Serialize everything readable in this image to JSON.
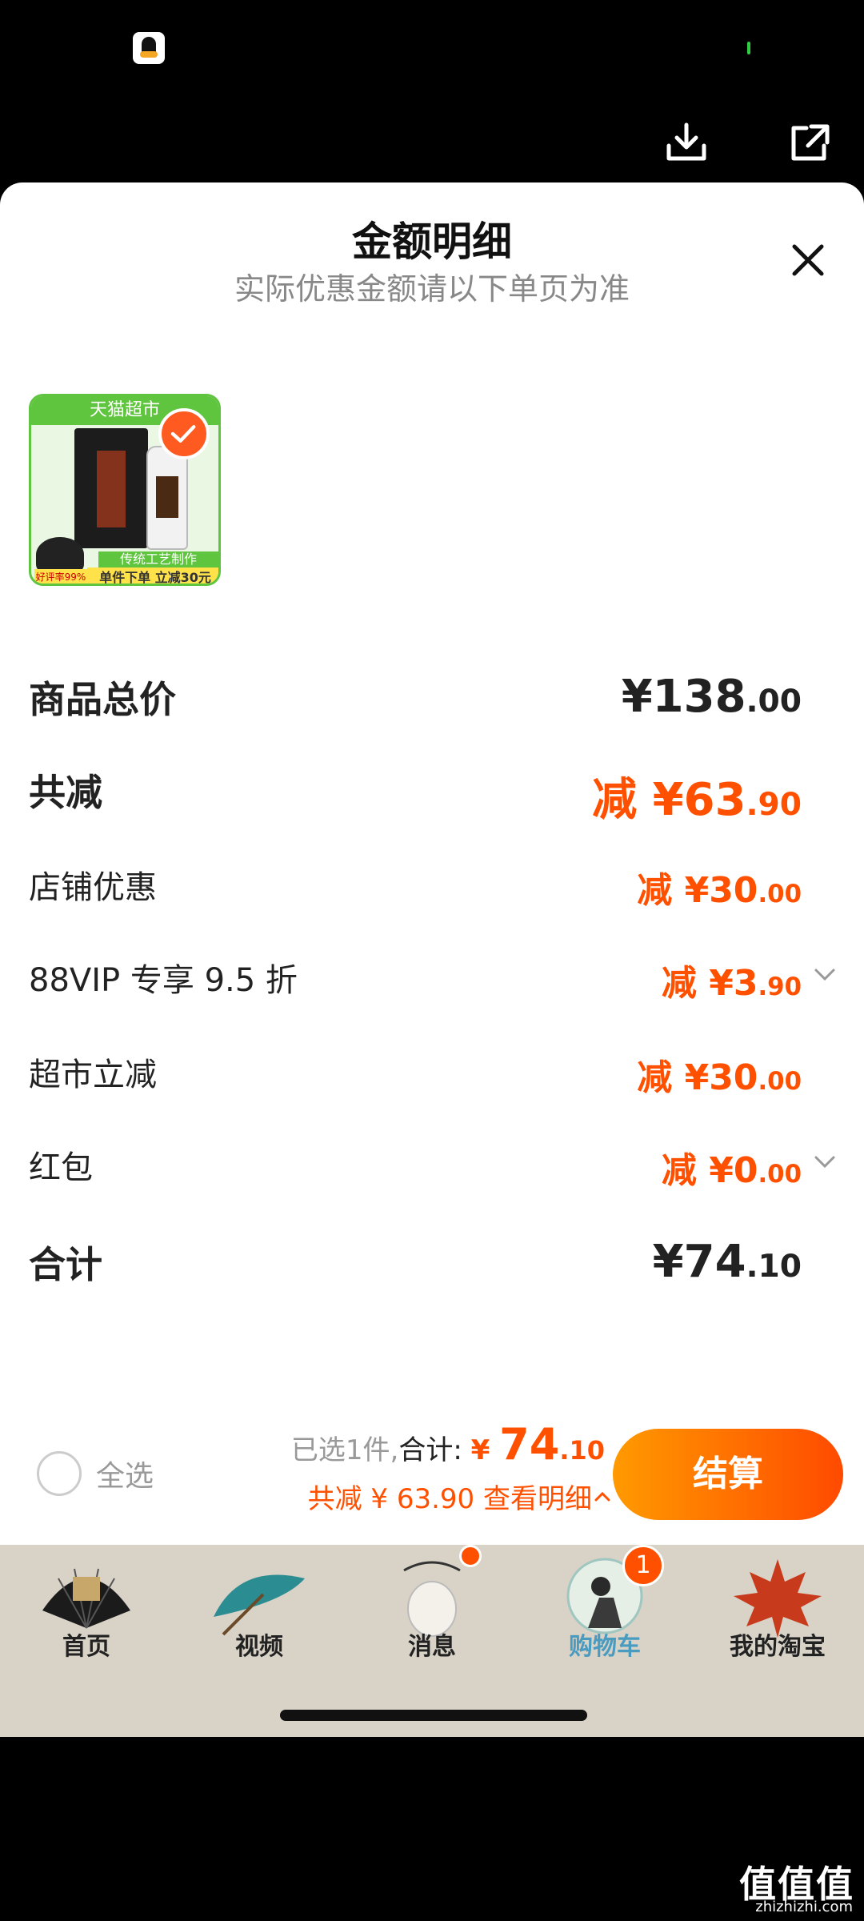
{
  "sheet": {
    "title": "金额明细",
    "subtitle": "实际优惠金额请以下单页为准"
  },
  "product": {
    "banner": "天猫超市",
    "craft_tag": "传统工艺制作",
    "promo_tag": "单件下单 立减30元",
    "rating_tag": "好评率99%"
  },
  "rows": [
    {
      "label": "商品总价",
      "prefix": "",
      "value_main": "¥138",
      "value_dec": ".00"
    },
    {
      "label": "共减",
      "prefix": "减 ",
      "value_main": "¥63",
      "value_dec": ".90"
    },
    {
      "label": "店铺优惠",
      "prefix": "减 ",
      "value_main": "¥30",
      "value_dec": ".00"
    },
    {
      "label": "88VIP 专享 9.5 折",
      "prefix": "减 ",
      "value_main": "¥3",
      "value_dec": ".90"
    },
    {
      "label": "超市立减",
      "prefix": "减 ",
      "value_main": "¥30",
      "value_dec": ".00"
    },
    {
      "label": "红包",
      "prefix": "减 ",
      "value_main": "¥0",
      "value_dec": ".00"
    },
    {
      "label": "合计",
      "prefix": "",
      "value_main": "¥74",
      "value_dec": ".10"
    }
  ],
  "bottom": {
    "select_all": "全选",
    "selected_count": "已选1件,",
    "total_label": "合计:",
    "total_currency": "¥",
    "total_main": "74",
    "total_dec": ".10",
    "discount_text": "共减 ¥ 63.90",
    "view_detail": "查看明细",
    "checkout": "结算"
  },
  "tabs": [
    {
      "label": "首页",
      "icon": "fan-icon"
    },
    {
      "label": "视频",
      "icon": "umbrella-icon"
    },
    {
      "label": "消息",
      "icon": "jade-pendant-icon"
    },
    {
      "label": "购物车",
      "icon": "archer-icon",
      "badge": "1"
    },
    {
      "label": "我的淘宝",
      "icon": "maple-leaf-icon"
    }
  ],
  "watermark": {
    "main": "值值值",
    "sub": "zhizhizhi.com"
  },
  "colors": {
    "accent": "#ff5000",
    "checkout_gradient_start": "#ff9a00",
    "checkout_gradient_end": "#ff4a00",
    "tabbar_bg": "#d8d2c7",
    "active_tab": "#4a9bc0"
  }
}
